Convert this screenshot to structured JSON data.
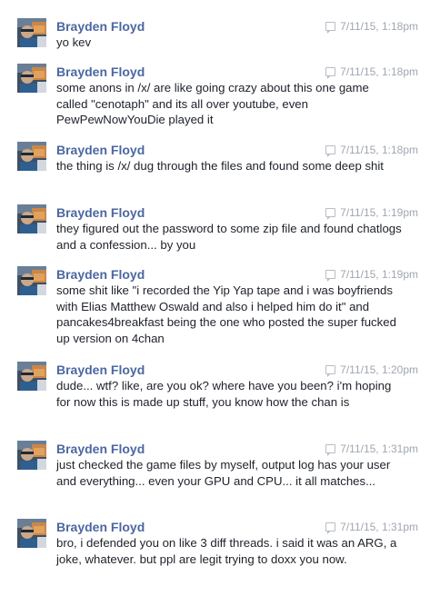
{
  "messages": [
    {
      "author": "Brayden Floyd",
      "timestamp": "7/11/15, 1:18pm",
      "text": "yo kev"
    },
    {
      "author": "Brayden Floyd",
      "timestamp": "7/11/15, 1:18pm",
      "text": "some anons in /x/ are like going crazy about this one game called \"cenotaph\" and its all over youtube, even PewPewNowYouDie played it"
    },
    {
      "author": "Brayden Floyd",
      "timestamp": "7/11/15, 1:18pm",
      "text": "the thing is /x/ dug through the files and found some deep shit"
    },
    {
      "author": "Brayden Floyd",
      "timestamp": "7/11/15, 1:19pm",
      "text": "they figured out the password to some zip file and found chatlogs and a confession... by you"
    },
    {
      "author": "Brayden Floyd",
      "timestamp": "7/11/15, 1:19pm",
      "text": "some shit like \"i recorded the Yip Yap tape and i was boyfriends with Elias Matthew Oswald and also i helped him do it\" and pancakes4breakfast being the one who posted the super fucked up version on 4chan"
    },
    {
      "author": "Brayden Floyd",
      "timestamp": "7/11/15, 1:20pm",
      "text": "dude... wtf? like, are you ok? where have you been? i'm hoping for now this is made up stuff, you know how the chan is"
    },
    {
      "author": "Brayden Floyd",
      "timestamp": "7/11/15, 1:31pm",
      "text": "just checked the game files by myself, output log has your user and everything... even your GPU and CPU... it all matches..."
    },
    {
      "author": "Brayden Floyd",
      "timestamp": "7/11/15, 1:31pm",
      "text": "bro, i defended you on like 3 diff threads. i said it was an ARG, a joke, whatever. but ppl are legit trying to doxx you now."
    }
  ]
}
